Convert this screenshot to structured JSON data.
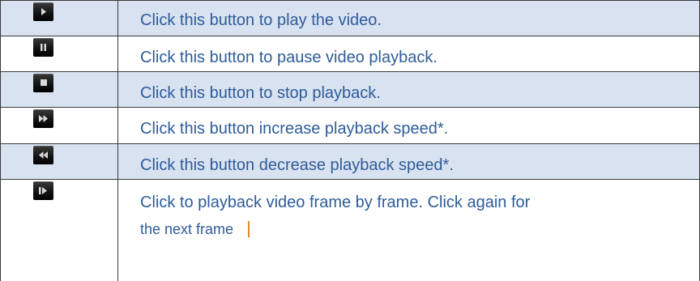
{
  "rows": [
    {
      "icon": "play-icon",
      "text": "Click this button to play the video."
    },
    {
      "icon": "pause-icon",
      "text": "Click this button to pause video playback."
    },
    {
      "icon": "stop-icon",
      "text": "Click this button to stop playback."
    },
    {
      "icon": "fast-forward-icon",
      "text": "Click this button increase playback speed*."
    },
    {
      "icon": "rewind-icon",
      "text": "Click this button decrease playback speed*."
    },
    {
      "icon": "frame-step-icon",
      "text_line1": "Click to playback video frame by frame. Click again for",
      "text_line2": "the next frame"
    }
  ]
}
